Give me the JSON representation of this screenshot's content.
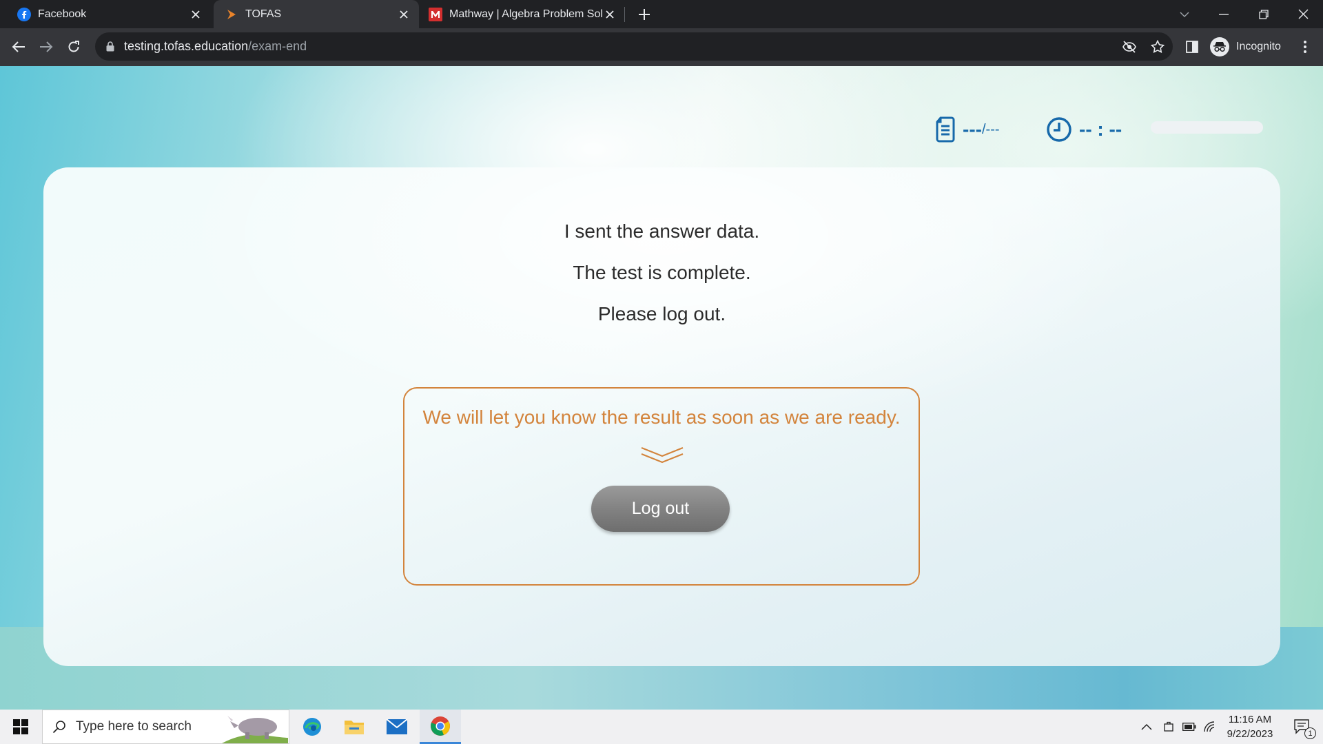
{
  "browser": {
    "tabs": [
      {
        "title": "Facebook",
        "icon": "facebook-icon"
      },
      {
        "title": "TOFAS",
        "icon": "tofas-icon"
      },
      {
        "title": "Mathway | Algebra Problem Solv",
        "icon": "mathway-icon"
      }
    ],
    "url_domain": "testing.tofas.education",
    "url_path": "/exam-end",
    "incognito_label": "Incognito"
  },
  "page": {
    "question_counter": "---",
    "question_total": "/---",
    "timer": "-- : --",
    "timer_progress": 0,
    "messages": [
      "I sent the answer data.",
      "The test is complete.",
      "Please log out."
    ],
    "result_notice": "We will let you know the result as soon as we are ready.",
    "logout_label": "Log out"
  },
  "taskbar": {
    "search_placeholder": "Type here to search",
    "time": "11:16 AM",
    "date": "9/22/2023",
    "notification_count": "1"
  },
  "colors": {
    "accent_orange": "#d3843c",
    "hud_blue": "#1769aa",
    "button_gray": "#808080"
  }
}
